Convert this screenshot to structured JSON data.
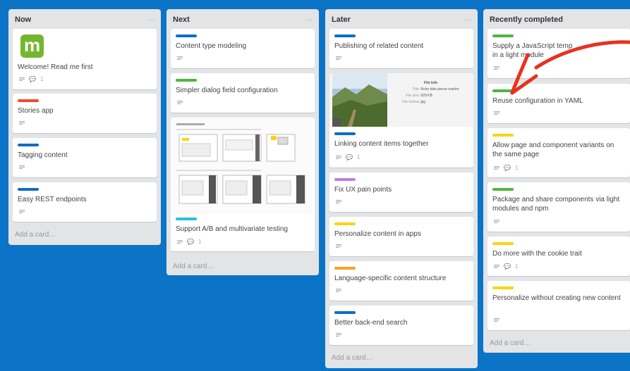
{
  "colors": {
    "board_bg": "#0b74c6",
    "label_blue": "#0a6fc2",
    "label_red": "#f04b2f",
    "label_green": "#4fb543",
    "label_yellow": "#f7d514",
    "label_purple": "#c07fd9",
    "label_orange": "#f5a623",
    "label_cyan": "#27c0e3",
    "arrow_red": "#e8321e",
    "logo_green": "#74b72e"
  },
  "lists": [
    {
      "title": "Now",
      "menu": "···",
      "add_card": "Add a card…",
      "cards": [
        {
          "title": "Welcome! Read me first",
          "comments": "1",
          "logo_letter": "m"
        },
        {
          "title": "Stories app"
        },
        {
          "title": "Tagging content"
        },
        {
          "title": "Easy REST endpoints"
        }
      ]
    },
    {
      "title": "Next",
      "menu": "···",
      "add_card": "Add a card…",
      "cards": [
        {
          "title": "Content type modeling"
        },
        {
          "title": "Simpler dialog field configuration"
        },
        {
          "title": "Support A/B and multivariate testing",
          "comments": "1"
        }
      ]
    },
    {
      "title": "Later",
      "menu": "···",
      "add_card": "Add a card…",
      "cards": [
        {
          "title": "Publishing of related content"
        },
        {
          "title": "Linking content items together",
          "comments": "1",
          "file_info": {
            "heading": "File Info",
            "title_label": "Title:",
            "title_value": "Rolor bike pierce marlen",
            "size_label": "File size:",
            "size_value": "629 KB",
            "format_label": "File format:",
            "format_value": "jpg"
          }
        },
        {
          "title": "Fix UX pain points"
        },
        {
          "title": "Personalize content in apps"
        },
        {
          "title": "Language-specific content structure"
        },
        {
          "title": "Better back-end search"
        }
      ]
    },
    {
      "title": "Recently completed",
      "menu": "···",
      "add_card": "Add a card…",
      "cards": [
        {
          "title_line1": "Supply a JavaScript temp",
          "title_line2": "in a light module"
        },
        {
          "title": "Reuse configuration in YAML"
        },
        {
          "title": "Allow page and component variants on the same page",
          "comments": "1"
        },
        {
          "title": "Package and share components via light modules and npm"
        },
        {
          "title": "Do more with the cookie trait",
          "comments": "1"
        },
        {
          "title": "Personalize without creating new content"
        }
      ]
    }
  ]
}
